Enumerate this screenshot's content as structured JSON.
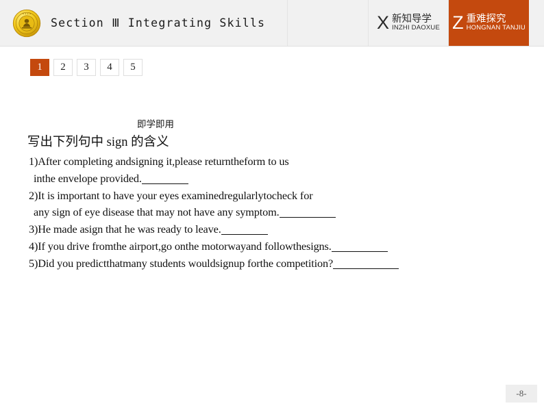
{
  "header": {
    "logo_name": "gold-seal-medallion",
    "section_title": "Section Ⅲ  Integrating Skills",
    "chips": [
      {
        "letter": "X",
        "cn": "新知导学",
        "pinyin": "INZHI DAOXUE",
        "active": false
      },
      {
        "letter": "Z",
        "cn": "重难探究",
        "pinyin": "HONGNAN TANJIU",
        "active": true
      }
    ]
  },
  "pager": {
    "items": [
      "1",
      "2",
      "3",
      "4",
      "5"
    ],
    "active_index": 0
  },
  "content": {
    "badge_label": "即学即用",
    "prompt": "写出下列句中 sign 的含义",
    "questions": [
      {
        "line1": "1)After completing andsigning it,please returntheform to us",
        "line2": " inthe envelope provided.",
        "blank": "sm"
      },
      {
        "line1": "2)It is important to have your eyes examinedregularlytocheck for",
        "line2": " any sign of eye disease that may not have any symptom.",
        "blank": "md"
      },
      {
        "line1": "3)He made asign that he was ready to leave.",
        "line2": "",
        "blank": "sm"
      },
      {
        "line1": "4)If you drive fromthe airport,go onthe motorwayand followthesigns.",
        "line2": "",
        "blank": "md"
      },
      {
        "line1": "5)Did you predictthatmany students wouldsignup forthe competition?",
        "line2": "",
        "blank": "lg"
      }
    ]
  },
  "footer": {
    "page_number": "-8-"
  },
  "colors": {
    "accent_orange": "#c4490e",
    "header_bg": "#f1f1f1",
    "text": "#111111"
  }
}
